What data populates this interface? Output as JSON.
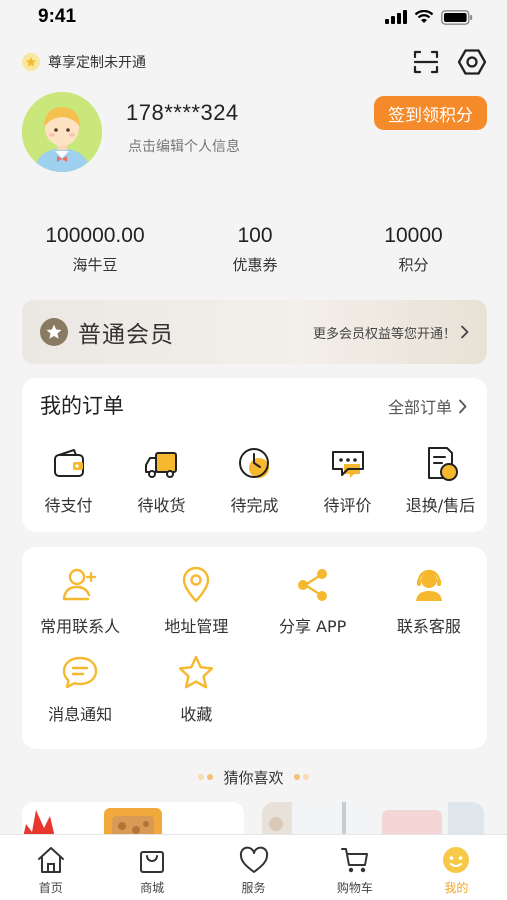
{
  "status_bar": {
    "time": "9:41"
  },
  "top": {
    "vip_note": "尊享定制未开通",
    "scan_icon": "scan-icon",
    "settings_icon": "settings-hexagon-icon"
  },
  "profile": {
    "phone": "178****324",
    "edit_hint": "点击编辑个人信息",
    "checkin_label": "签到领积分"
  },
  "stats": [
    {
      "value": "100000.00",
      "label": "海牛豆"
    },
    {
      "value": "100",
      "label": "优惠券"
    },
    {
      "value": "10000",
      "label": "积分"
    }
  ],
  "member": {
    "title": "普通会员",
    "more": "更多会员权益等您开通！"
  },
  "orders": {
    "title": "我的订单",
    "all_label": "全部订单",
    "items": [
      {
        "label": "待支付",
        "icon": "wallet-icon"
      },
      {
        "label": "待收货",
        "icon": "truck-icon"
      },
      {
        "label": "待完成",
        "icon": "clock-icon"
      },
      {
        "label": "待评价",
        "icon": "comment-icon"
      },
      {
        "label": "退换/售后",
        "icon": "after-sale-icon"
      }
    ]
  },
  "services": {
    "items": [
      {
        "label": "常用联系人",
        "icon": "contact-add-icon"
      },
      {
        "label": "地址管理",
        "icon": "location-pin-icon"
      },
      {
        "label": "分享 APP",
        "icon": "share-icon"
      },
      {
        "label": "联系客服",
        "icon": "customer-service-icon"
      },
      {
        "label": "消息通知",
        "icon": "message-icon"
      },
      {
        "label": "收藏",
        "icon": "star-icon"
      }
    ]
  },
  "guess": {
    "label": "猜你喜欢"
  },
  "tabbar": {
    "items": [
      {
        "label": "首页",
        "icon": "home-icon"
      },
      {
        "label": "商城",
        "icon": "shopping-bag-icon"
      },
      {
        "label": "服务",
        "icon": "heart-icon"
      },
      {
        "label": "购物车",
        "icon": "cart-icon"
      },
      {
        "label": "我的",
        "icon": "mine-icon"
      }
    ],
    "active_index": 4
  },
  "colors": {
    "accent_orange": "#f58a2a",
    "icon_yellow": "#f5b82e",
    "active_tab": "#f5a623"
  }
}
